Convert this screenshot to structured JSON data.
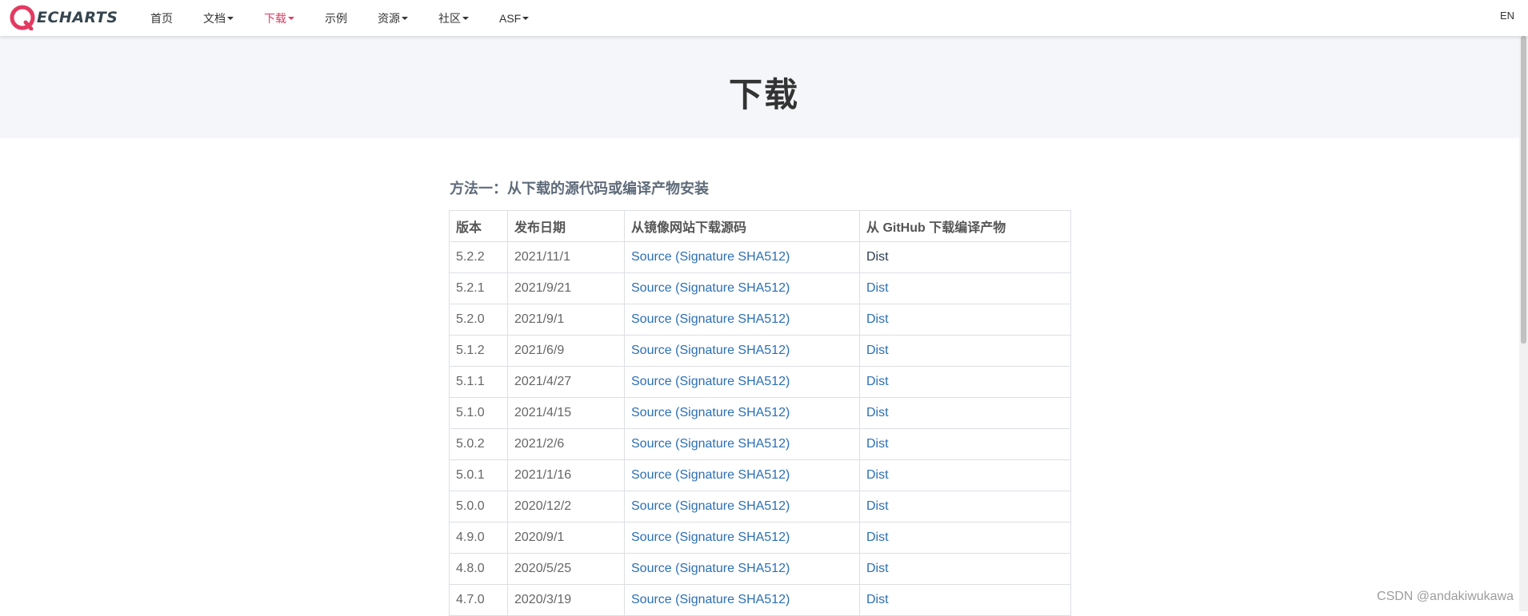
{
  "navbar": {
    "logo_text": "ECHARTS",
    "items": [
      {
        "label": "首页",
        "dropdown": false,
        "active": false
      },
      {
        "label": "文档",
        "dropdown": true,
        "active": false
      },
      {
        "label": "下载",
        "dropdown": true,
        "active": true
      },
      {
        "label": "示例",
        "dropdown": false,
        "active": false
      },
      {
        "label": "资源",
        "dropdown": true,
        "active": false
      },
      {
        "label": "社区",
        "dropdown": true,
        "active": false
      },
      {
        "label": "ASF",
        "dropdown": true,
        "active": false
      }
    ],
    "lang": "EN"
  },
  "page": {
    "title": "下载"
  },
  "section": {
    "title": "方法一：从下载的源代码或编译产物安装",
    "table": {
      "headers": [
        "版本",
        "发布日期",
        "从镜像网站下载源码",
        "从 GitHub 下载编译产物"
      ],
      "rows": [
        {
          "version": "5.2.2",
          "date": "2021/11/1",
          "source": "Source (Signature SHA512)",
          "dist": "Dist"
        },
        {
          "version": "5.2.1",
          "date": "2021/9/21",
          "source": "Source (Signature SHA512)",
          "dist": "Dist"
        },
        {
          "version": "5.2.0",
          "date": "2021/9/1",
          "source": "Source (Signature SHA512)",
          "dist": "Dist"
        },
        {
          "version": "5.1.2",
          "date": "2021/6/9",
          "source": "Source (Signature SHA512)",
          "dist": "Dist"
        },
        {
          "version": "5.1.1",
          "date": "2021/4/27",
          "source": "Source (Signature SHA512)",
          "dist": "Dist"
        },
        {
          "version": "5.1.0",
          "date": "2021/4/15",
          "source": "Source (Signature SHA512)",
          "dist": "Dist"
        },
        {
          "version": "5.0.2",
          "date": "2021/2/6",
          "source": "Source (Signature SHA512)",
          "dist": "Dist"
        },
        {
          "version": "5.0.1",
          "date": "2021/1/16",
          "source": "Source (Signature SHA512)",
          "dist": "Dist"
        },
        {
          "version": "5.0.0",
          "date": "2020/12/2",
          "source": "Source (Signature SHA512)",
          "dist": "Dist"
        },
        {
          "version": "4.9.0",
          "date": "2020/9/1",
          "source": "Source (Signature SHA512)",
          "dist": "Dist"
        },
        {
          "version": "4.8.0",
          "date": "2020/5/25",
          "source": "Source (Signature SHA512)",
          "dist": "Dist"
        },
        {
          "version": "4.7.0",
          "date": "2020/3/19",
          "source": "Source (Signature SHA512)",
          "dist": "Dist"
        }
      ]
    }
  },
  "watermark": "CSDN @andakiwukawa",
  "colors": {
    "accent": "#e43961",
    "link": "#2b6fb6",
    "header_bg": "#f4f6f9"
  }
}
